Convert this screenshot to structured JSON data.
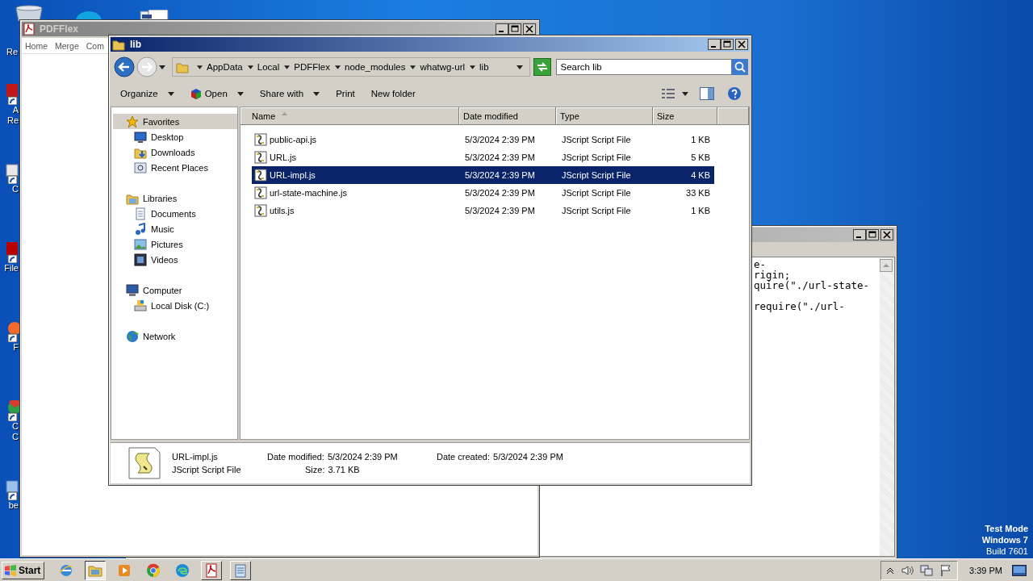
{
  "desktop": {
    "icons": [
      {
        "kind": "recycle",
        "lines": [
          "Re"
        ]
      },
      {
        "kind": "pdf",
        "lines": [
          "A",
          "Re"
        ]
      },
      {
        "kind": "ccleaner",
        "lines": [
          "C"
        ]
      },
      {
        "kind": "filezilla",
        "lines": [
          "File"
        ]
      },
      {
        "kind": "firefox",
        "lines": [
          "F"
        ]
      },
      {
        "kind": "chrome",
        "lines": [
          "C",
          "C"
        ]
      },
      {
        "kind": "doc",
        "lines": [
          "be"
        ]
      }
    ],
    "os_notice": [
      "Test Mode",
      "Windows 7",
      "Build 7601"
    ]
  },
  "pdfflex_window": {
    "title": "PDFFlex",
    "menu": [
      "Home",
      "Merge",
      "Com"
    ]
  },
  "editor_window": {
    "lines": [
      {
        "text": "e-",
        "gap_before": false
      },
      {
        "text": "rigin;",
        "gap_before": false
      },
      {
        "text": "quire(\"./url-state-",
        "gap_before": false
      },
      {
        "text": "require(\"./url-",
        "gap_before": true
      }
    ]
  },
  "explorer": {
    "title": "lib",
    "breadcrumb": [
      "AppData",
      "Local",
      "PDFFlex",
      "node_modules",
      "whatwg-url",
      "lib"
    ],
    "search": {
      "placeholder": "Search lib"
    },
    "toolbar": [
      {
        "label": "Organize",
        "kind": "plain",
        "dropdown": true
      },
      {
        "label": "Open",
        "kind": "open",
        "dropdown": true
      },
      {
        "label": "Share with",
        "kind": "plain",
        "dropdown": true
      },
      {
        "label": "Print",
        "kind": "plain",
        "dropdown": false
      },
      {
        "label": "New folder",
        "kind": "plain",
        "dropdown": false
      }
    ],
    "nav": [
      {
        "label": "Favorites",
        "kind": "star",
        "selected": true,
        "children": [
          {
            "label": "Desktop",
            "kind": "desktop",
            "selected": false
          },
          {
            "label": "Downloads",
            "kind": "downloads",
            "selected": false
          },
          {
            "label": "Recent Places",
            "kind": "recent",
            "selected": false
          }
        ]
      },
      {
        "label": "Libraries",
        "kind": "libraries",
        "selected": false,
        "children": [
          {
            "label": "Documents",
            "kind": "documents",
            "selected": false
          },
          {
            "label": "Music",
            "kind": "music",
            "selected": false
          },
          {
            "label": "Pictures",
            "kind": "pictures",
            "selected": false
          },
          {
            "label": "Videos",
            "kind": "videos",
            "selected": false
          }
        ]
      },
      {
        "label": "Computer",
        "kind": "computer",
        "selected": false,
        "children": [
          {
            "label": "Local Disk (C:)",
            "kind": "disk",
            "selected": false
          }
        ]
      },
      {
        "label": "Network",
        "kind": "network",
        "selected": false
      }
    ],
    "columns": [
      {
        "label": "Name",
        "sorted": true
      },
      {
        "label": "Date modified",
        "sorted": false
      },
      {
        "label": "Type",
        "sorted": false
      },
      {
        "label": "Size",
        "sorted": false
      }
    ],
    "rows": [
      {
        "name": "public-api.js",
        "date": "5/3/2024 2:39 PM",
        "type": "JScript Script File",
        "size": "1 KB",
        "selected": false
      },
      {
        "name": "URL.js",
        "date": "5/3/2024 2:39 PM",
        "type": "JScript Script File",
        "size": "5 KB",
        "selected": false
      },
      {
        "name": "URL-impl.js",
        "date": "5/3/2024 2:39 PM",
        "type": "JScript Script File",
        "size": "4 KB",
        "selected": true
      },
      {
        "name": "url-state-machine.js",
        "date": "5/3/2024 2:39 PM",
        "type": "JScript Script File",
        "size": "33 KB",
        "selected": false
      },
      {
        "name": "utils.js",
        "date": "5/3/2024 2:39 PM",
        "type": "JScript Script File",
        "size": "1 KB",
        "selected": false
      }
    ],
    "details": {
      "name": "URL-impl.js",
      "type": "JScript Script File",
      "fields": [
        {
          "label": "Date modified:",
          "value": "5/3/2024 2:39 PM"
        },
        {
          "label": "Size:",
          "value": "3.71 KB"
        },
        {
          "label": "Date created:",
          "value": "5/3/2024 2:39 PM"
        }
      ]
    }
  },
  "taskbar": {
    "start": "Start",
    "apps": [
      {
        "kind": "ie",
        "selected": false
      },
      {
        "kind": "explorer",
        "selected": true
      },
      {
        "kind": "media",
        "selected": false
      },
      {
        "kind": "chrome",
        "selected": false
      },
      {
        "kind": "edge",
        "selected": false
      },
      {
        "kind": "pdf",
        "selected": false
      },
      {
        "kind": "notepad",
        "selected": false
      }
    ],
    "clock": "3:39 PM"
  }
}
